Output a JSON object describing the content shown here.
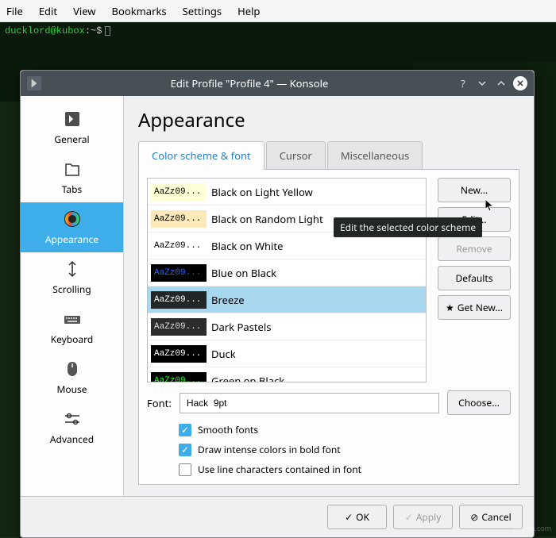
{
  "menubar": [
    "File",
    "Edit",
    "View",
    "Bookmarks",
    "Settings",
    "Help"
  ],
  "terminal": {
    "prompt_user": "ducklord@kubox",
    "prompt_sep": ":~$"
  },
  "dialog": {
    "title": "Edit Profile \"Profile 4\" — Konsole",
    "heading": "Appearance",
    "tooltip": "Edit the selected color scheme"
  },
  "sidebar": {
    "items": [
      {
        "label": "General"
      },
      {
        "label": "Tabs"
      },
      {
        "label": "Appearance"
      },
      {
        "label": "Scrolling"
      },
      {
        "label": "Keyboard"
      },
      {
        "label": "Mouse"
      },
      {
        "label": "Advanced"
      }
    ]
  },
  "tabs": [
    "Color scheme & font",
    "Cursor",
    "Miscellaneous"
  ],
  "schemes": {
    "sample": "AaZz09...",
    "items": [
      {
        "name": "Black on Light Yellow",
        "bg": "#ffffd8",
        "fg": "#000000"
      },
      {
        "name": "Black on Random Light",
        "bg": "#fce8b8",
        "fg": "#000000"
      },
      {
        "name": "Black on White",
        "bg": "#ffffff",
        "fg": "#000000"
      },
      {
        "name": "Blue on Black",
        "bg": "#000000",
        "fg": "#2266ff"
      },
      {
        "name": "Breeze",
        "bg": "#232627",
        "fg": "#ffffff",
        "selected": true
      },
      {
        "name": "Dark Pastels",
        "bg": "#2c2c2c",
        "fg": "#dcdcdc"
      },
      {
        "name": "Duck",
        "bg": "#000000",
        "fg": "#ffffff"
      },
      {
        "name": "Green on Black",
        "bg": "#000000",
        "fg": "#18ff18"
      }
    ]
  },
  "scheme_buttons": {
    "new": "New...",
    "edit": "Edit...",
    "remove": "Remove",
    "defaults": "Defaults",
    "getnew": "Get New..."
  },
  "font": {
    "label": "Font:",
    "value": "Hack  9pt",
    "choose": "Choose..."
  },
  "checks": [
    {
      "label": "Smooth fonts",
      "checked": true
    },
    {
      "label": "Draw intense colors in bold font",
      "checked": true
    },
    {
      "label": "Use line characters contained in font",
      "checked": false
    }
  ],
  "footer": {
    "ok": "OK",
    "apply": "Apply",
    "cancel": "Cancel"
  }
}
